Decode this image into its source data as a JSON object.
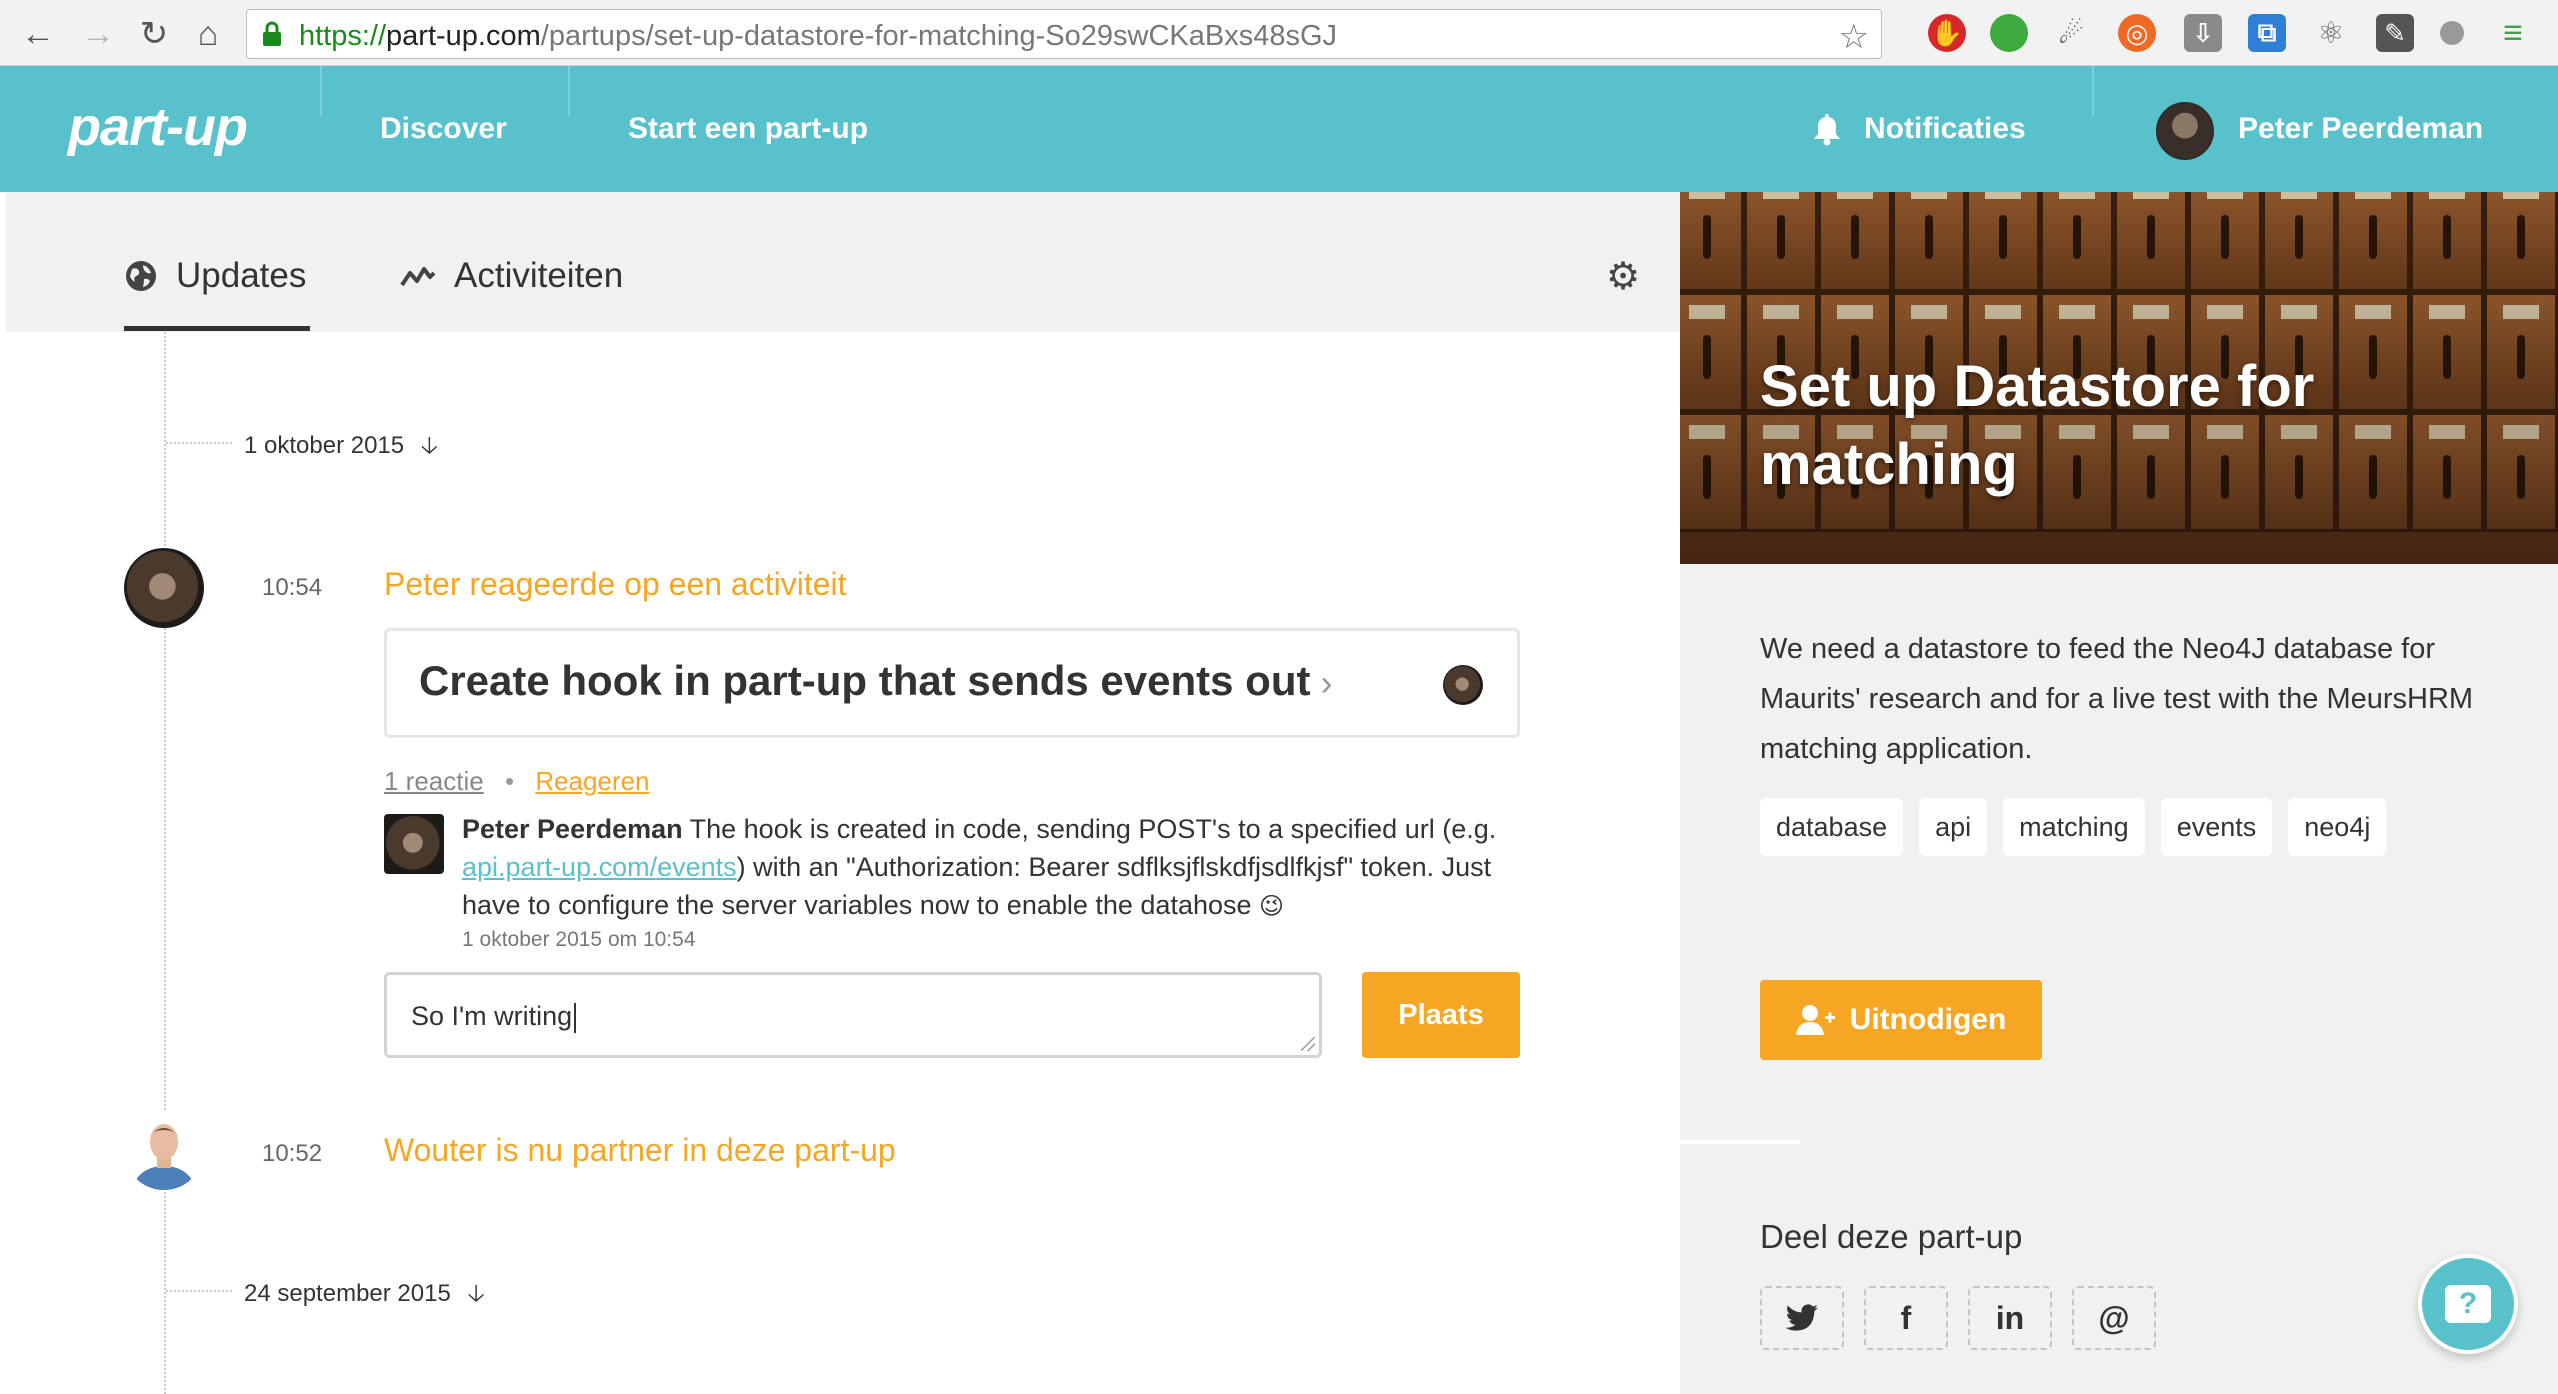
{
  "browser": {
    "url_scheme": "https://",
    "url_host": "part-up.com",
    "url_path": "/partups/set-up-datastore-for-matching-So29swCKaBxs48sGJ"
  },
  "header": {
    "logo": "part-up",
    "nav": [
      {
        "label": "Discover"
      },
      {
        "label": "Start een part-up"
      }
    ],
    "notifications_label": "Notificaties",
    "user_name": "Peter Peerdeman"
  },
  "tabs": [
    {
      "label": "Updates",
      "active": true
    },
    {
      "label": "Activiteiten",
      "active": false
    }
  ],
  "timeline": {
    "date_1": "1 oktober 2015",
    "date_2": "24 september 2015",
    "update_1": {
      "time": "10:54",
      "title": "Peter reageerde op een activiteit",
      "card_title": "Create hook in part-up that sends events out",
      "card_chevron": "›",
      "reactions": "1 reactie",
      "separator": "•",
      "reply_label": "Reageren",
      "comment": {
        "author": "Peter Peerdeman",
        "text_before_link": "The hook is created in code, sending POST's to a specified url (e.g.",
        "link": "api.part-up.com/events",
        "text_after_link": ") with an \"Authorization: Bearer sdflksjflskdfjsdlfkjsf\" token. Just have to configure the server variables now to enable the datahose",
        "emoji": "😉",
        "date": "1 oktober 2015 om 10:54"
      },
      "input_value": "So I'm writing",
      "submit_label": "Plaats"
    },
    "update_2": {
      "time": "10:52",
      "title": "Wouter is nu partner in deze part-up"
    }
  },
  "partup": {
    "title": "Set up Datastore for matching",
    "description": "We need a datastore to feed the Neo4J database for Maurits' research and for a live test with the MeursHRM matching application.",
    "tags": [
      "database",
      "api",
      "matching",
      "events",
      "neo4j"
    ],
    "invite_label": "Uitnodigen",
    "share_title": "Deel deze part-up",
    "share_buttons": [
      {
        "icon": "twitter-icon",
        "glyph": "🐦"
      },
      {
        "icon": "facebook-icon",
        "glyph": "f"
      },
      {
        "icon": "linkedin-icon",
        "glyph": "in"
      },
      {
        "icon": "email-icon",
        "glyph": "@"
      }
    ],
    "help_glyph": "?"
  },
  "colors": {
    "brand": "#59c1cb",
    "accent": "#f6a623"
  }
}
